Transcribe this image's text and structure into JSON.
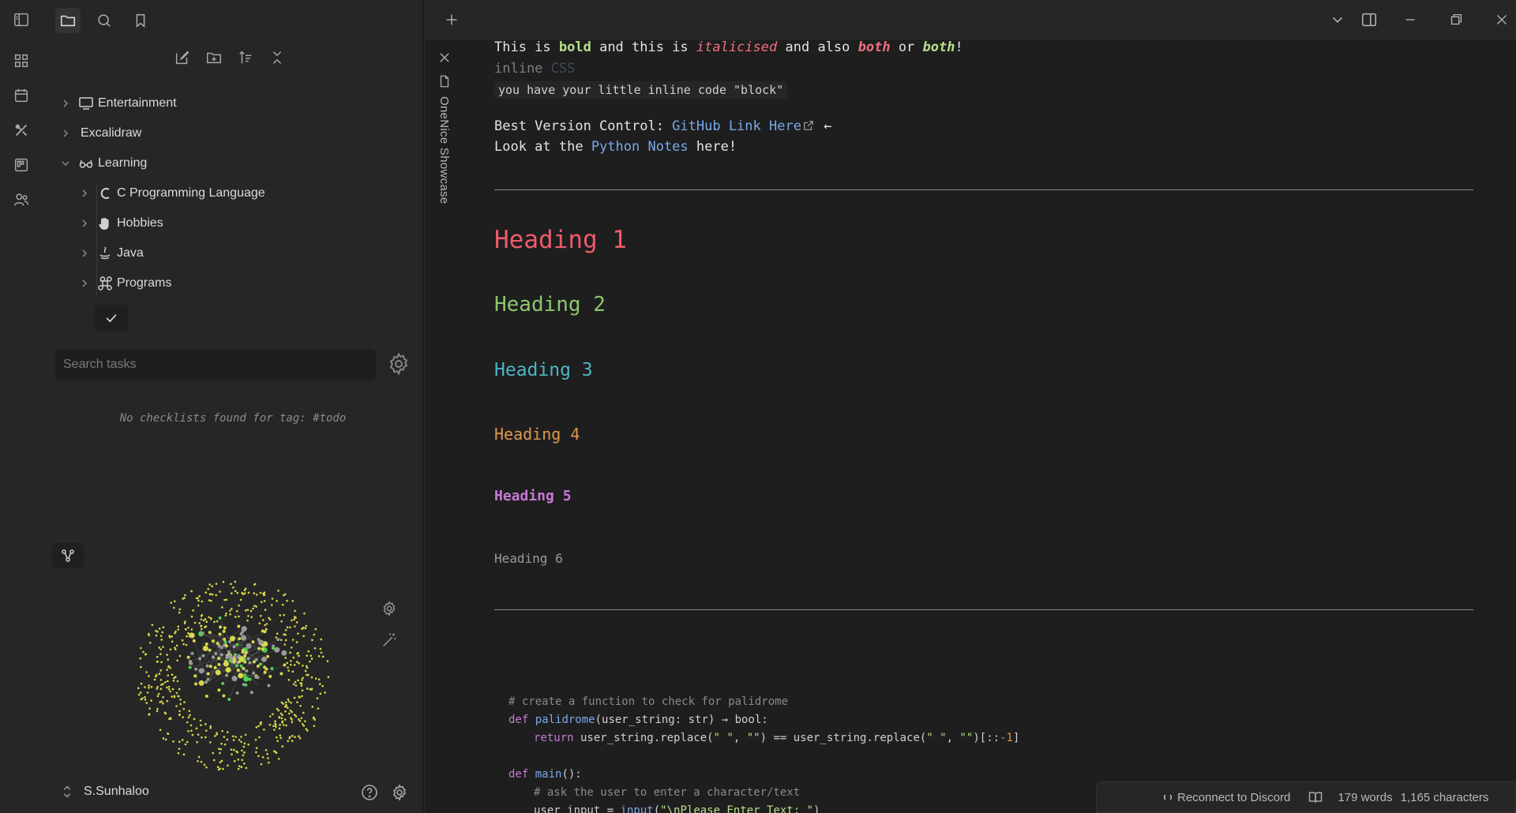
{
  "file_tree": {
    "items": [
      {
        "label": "Entertainment",
        "icon": "monitor-icon",
        "expanded": false
      },
      {
        "label": "Excalidraw",
        "icon": "",
        "expanded": false
      },
      {
        "label": "Learning",
        "icon": "glasses-icon",
        "expanded": true
      }
    ],
    "children": [
      {
        "label": "C Programming Language",
        "icon": "c-icon"
      },
      {
        "label": "Hobbies",
        "icon": "hand-icon"
      },
      {
        "label": "Java",
        "icon": "java-icon"
      },
      {
        "label": "Programs",
        "icon": "command-icon"
      }
    ]
  },
  "tasks": {
    "search_placeholder": "Search tasks",
    "empty_message": "No checklists found for tag: #todo"
  },
  "vault": {
    "name": "S.Sunhaloo"
  },
  "tab": {
    "title": "OneNice Showcase"
  },
  "note": {
    "line1": {
      "p1": "This is ",
      "bold": "bold",
      "p2": " and this is ",
      "italic": "italicised",
      "p3": " and also ",
      "both1": "both",
      "p4": " or ",
      "both2": "both",
      "p5": "!"
    },
    "line2": {
      "inline": "inline",
      "css": "CSS"
    },
    "line3": {
      "code": "you have your little inline code \"block\""
    },
    "line4": {
      "prefix": "Best Version Control: ",
      "link": "GitHub Link Here",
      "arrow": "←"
    },
    "line5": {
      "prefix": "Look at the ",
      "link": "Python Notes",
      "suffix": " here!"
    },
    "headings": [
      "Heading 1",
      "Heading 2",
      "Heading 3",
      "Heading 4",
      "Heading 5",
      "Heading 6"
    ],
    "code": {
      "l1": "# create a function to check for palidrome",
      "l2_kw": "def",
      "l2_fn": "palidrome",
      "l2_rest": "(user_string: str) → bool:",
      "l3_kw": "return",
      "l3_a": " user_string.replace(",
      "l3_s1": "\" \"",
      "l3_b": ", ",
      "l3_s2": "\"\"",
      "l3_c": ") == user_string.replace(",
      "l3_s3": "\" \"",
      "l3_d": ", ",
      "l3_s4": "\"\"",
      "l3_e": ")[::",
      "l3_num": "-1",
      "l3_f": "]",
      "l5_kw": "def",
      "l5_fn": "main",
      "l5_rest": "():",
      "l6": "# ask the user to enter a character/text",
      "l7_a": "user_input = ",
      "l7_fn": "input",
      "l7_b": "(",
      "l7_s": "\"\\nPlease Enter Text: \"",
      "l7_c": ")"
    }
  },
  "status": {
    "discord": "Reconnect to Discord",
    "words": "179 words",
    "chars": "1,165 characters"
  },
  "colors": {
    "bg": "#1e1e1e",
    "sidebar": "#262626",
    "h1": "#ef5b6b",
    "h2": "#8dc66e",
    "h3": "#4fb4c5",
    "h4": "#e0974f",
    "h5": "#c77ad6",
    "link": "#7aa8ea"
  }
}
